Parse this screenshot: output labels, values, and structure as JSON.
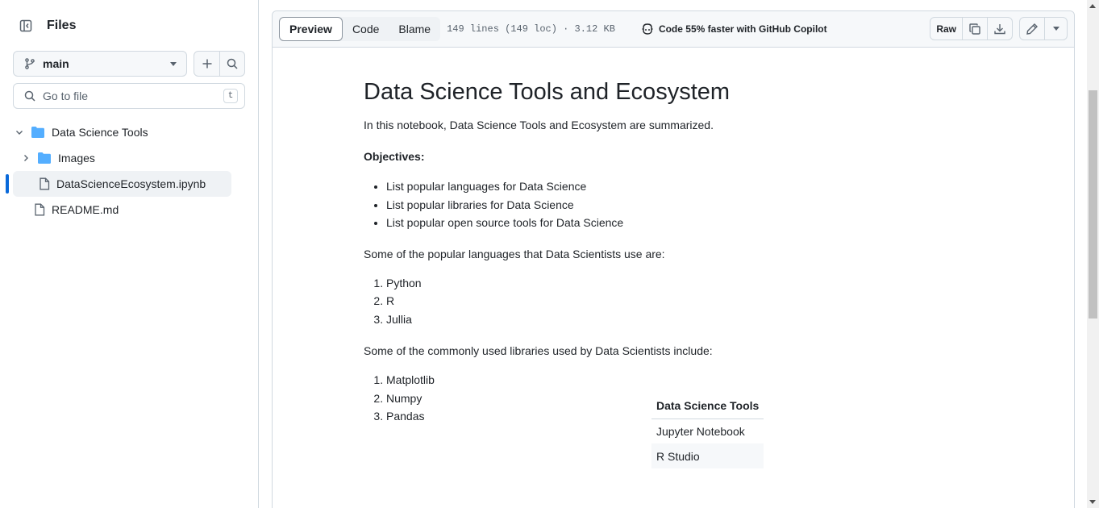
{
  "sidebar": {
    "title": "Files",
    "branch": "main",
    "search_placeholder": "Go to file",
    "search_shortcut": "t",
    "tree": [
      {
        "label": "Data Science Tools",
        "type": "folder",
        "expanded": true
      },
      {
        "label": "Images",
        "type": "folder",
        "expanded": false
      },
      {
        "label": "DataScienceEcosystem.ipynb",
        "type": "file",
        "active": true
      },
      {
        "label": "README.md",
        "type": "file"
      }
    ]
  },
  "toolbar": {
    "tabs": [
      "Preview",
      "Code",
      "Blame"
    ],
    "selected_tab": "Preview",
    "meta": "149 lines (149 loc) · 3.12 KB",
    "copilot": "Code 55% faster with GitHub Copilot",
    "raw_label": "Raw"
  },
  "notebook": {
    "title": "Data Science Tools and Ecosystem",
    "intro": "In this notebook, Data Science Tools and Ecosystem are summarized.",
    "objectives_heading": "Objectives:",
    "objectives": [
      "List popular languages for Data Science",
      "List popular libraries for Data Science",
      "List popular open source tools for Data Science"
    ],
    "languages_intro": "Some of the popular languages that Data Scientists use are:",
    "languages": [
      "Python",
      "R",
      "Jullia"
    ],
    "libraries_intro": "Some of the commonly used libraries used by Data Scientists include:",
    "libraries": [
      "Matplotlib",
      "Numpy",
      "Pandas"
    ],
    "table": {
      "header": "Data Science Tools",
      "rows": [
        "Jupyter Notebook",
        "R Studio"
      ]
    }
  },
  "colors": {
    "accent": "#0969da",
    "folder": "#54aeff",
    "border": "#d1d9e0"
  }
}
